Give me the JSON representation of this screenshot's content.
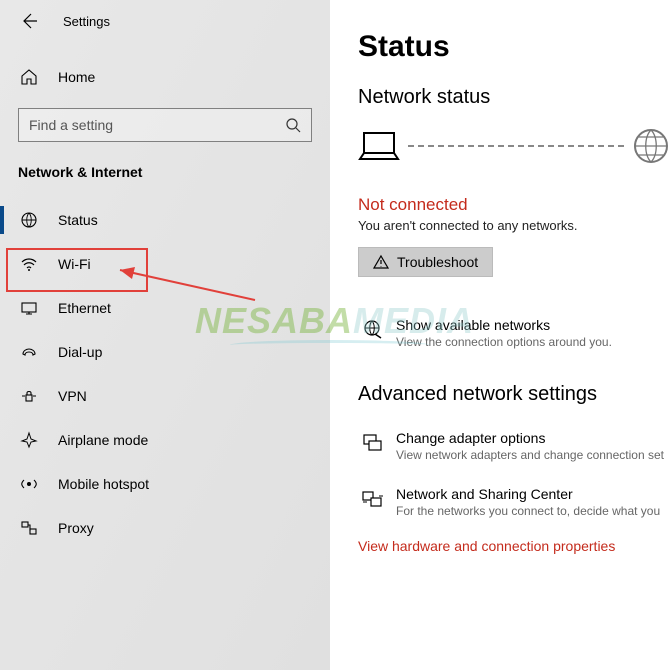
{
  "header": {
    "app_title": "Settings"
  },
  "sidebar": {
    "home_label": "Home",
    "search_placeholder": "Find a setting",
    "category": "Network & Internet",
    "items": [
      {
        "label": "Status"
      },
      {
        "label": "Wi-Fi"
      },
      {
        "label": "Ethernet"
      },
      {
        "label": "Dial-up"
      },
      {
        "label": "VPN"
      },
      {
        "label": "Airplane mode"
      },
      {
        "label": "Mobile hotspot"
      },
      {
        "label": "Proxy"
      }
    ]
  },
  "main": {
    "page_title": "Status",
    "network_status_heading": "Network status",
    "not_connected_title": "Not connected",
    "not_connected_sub": "You aren't connected to any networks.",
    "troubleshoot_label": "Troubleshoot",
    "available_title": "Show available networks",
    "available_sub": "View the connection options around you.",
    "advanced_heading": "Advanced network settings",
    "adapter_title": "Change adapter options",
    "adapter_sub": "View network adapters and change connection set",
    "sharing_title": "Network and Sharing Center",
    "sharing_sub": "For the networks you connect to, decide what you",
    "hw_link": "View hardware and connection properties"
  },
  "watermark": {
    "text1": "NESABA",
    "text2": "MEDIA"
  }
}
